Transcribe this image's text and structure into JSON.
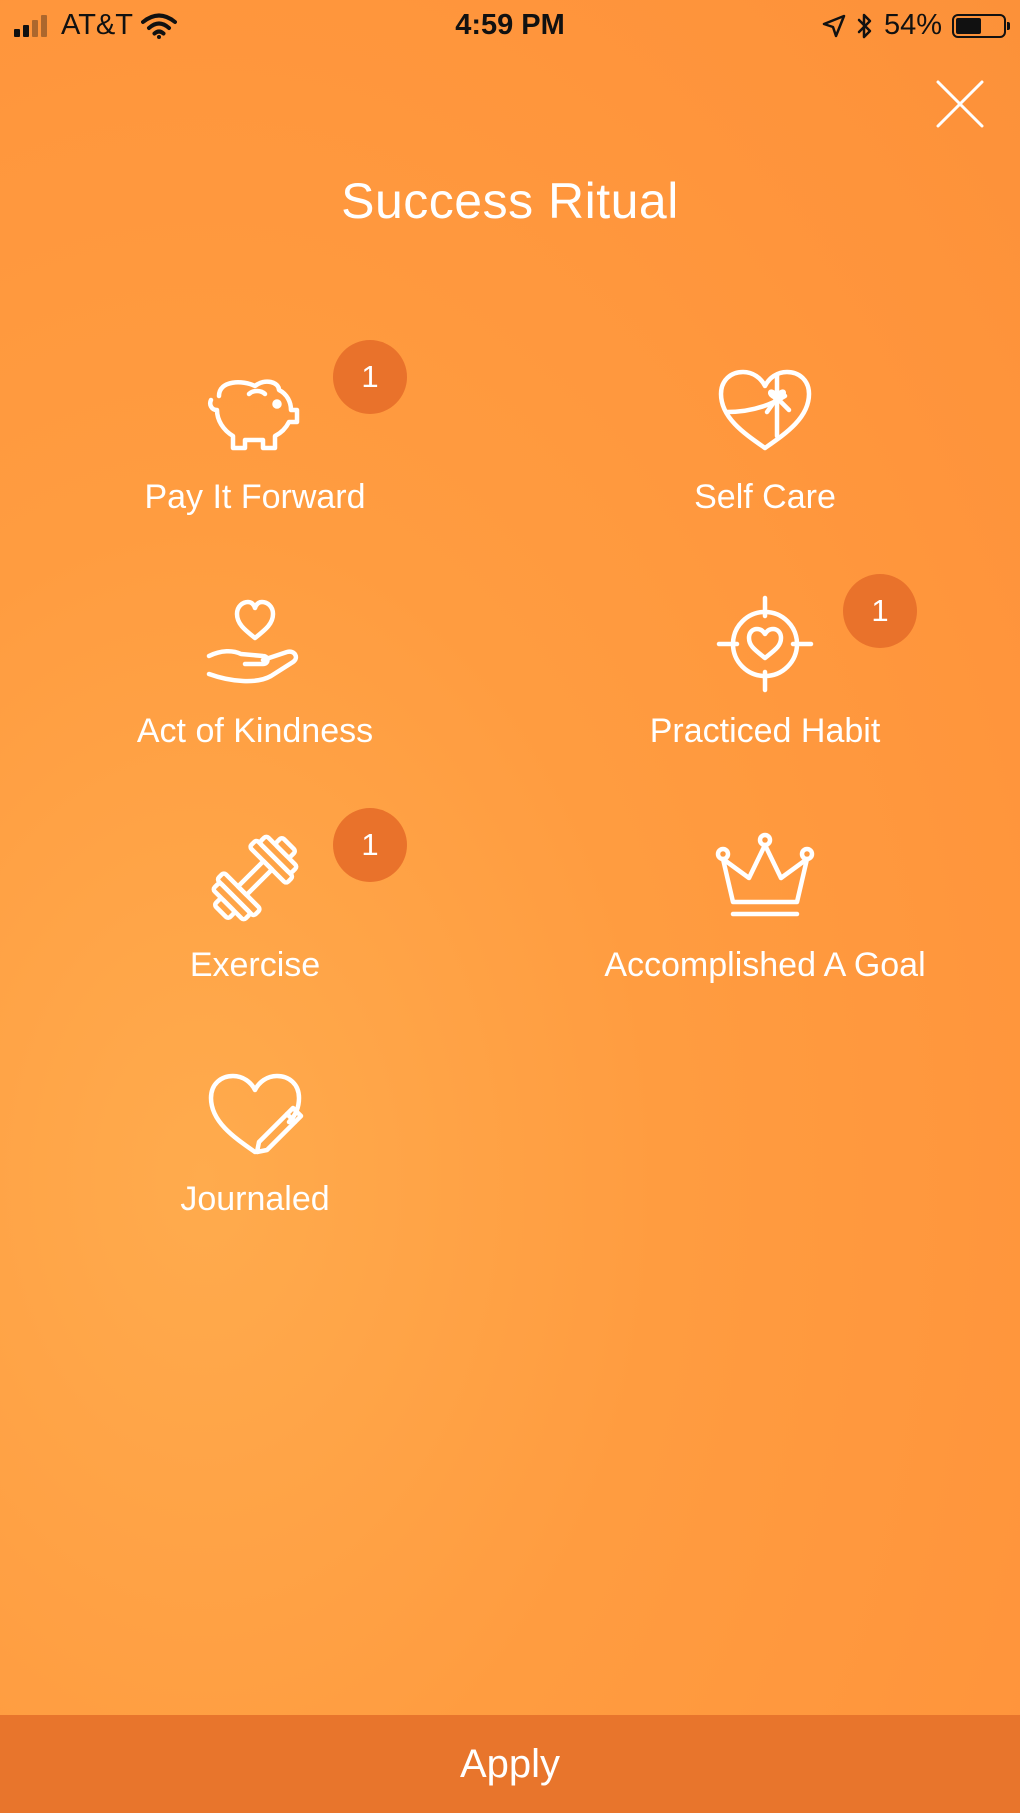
{
  "status_bar": {
    "carrier": "AT&T",
    "time": "4:59 PM",
    "battery_percent": "54%",
    "battery_level": 0.54,
    "icons": [
      "signal-icon",
      "wifi-icon",
      "location-icon",
      "bluetooth-icon",
      "battery-icon"
    ]
  },
  "header": {
    "title": "Success Ritual",
    "close_icon": "close-icon"
  },
  "rituals": [
    {
      "label": "Pay It Forward",
      "icon": "piggy-bank-icon",
      "badge": "1"
    },
    {
      "label": "Self Care",
      "icon": "heart-gift-icon",
      "badge": null
    },
    {
      "label": "Act of Kindness",
      "icon": "hand-heart-icon",
      "badge": null
    },
    {
      "label": "Practiced Habit",
      "icon": "target-heart-icon",
      "badge": "1"
    },
    {
      "label": "Exercise",
      "icon": "dumbbell-icon",
      "badge": "1"
    },
    {
      "label": "Accomplished A Goal",
      "icon": "crown-icon",
      "badge": null
    },
    {
      "label": "Journaled",
      "icon": "heart-pencil-icon",
      "badge": null
    }
  ],
  "footer": {
    "apply_label": "Apply"
  },
  "colors": {
    "background": "#ff9c40",
    "badge": "#e9722b",
    "apply_bar": "#e8752c",
    "text": "#ffffff"
  }
}
